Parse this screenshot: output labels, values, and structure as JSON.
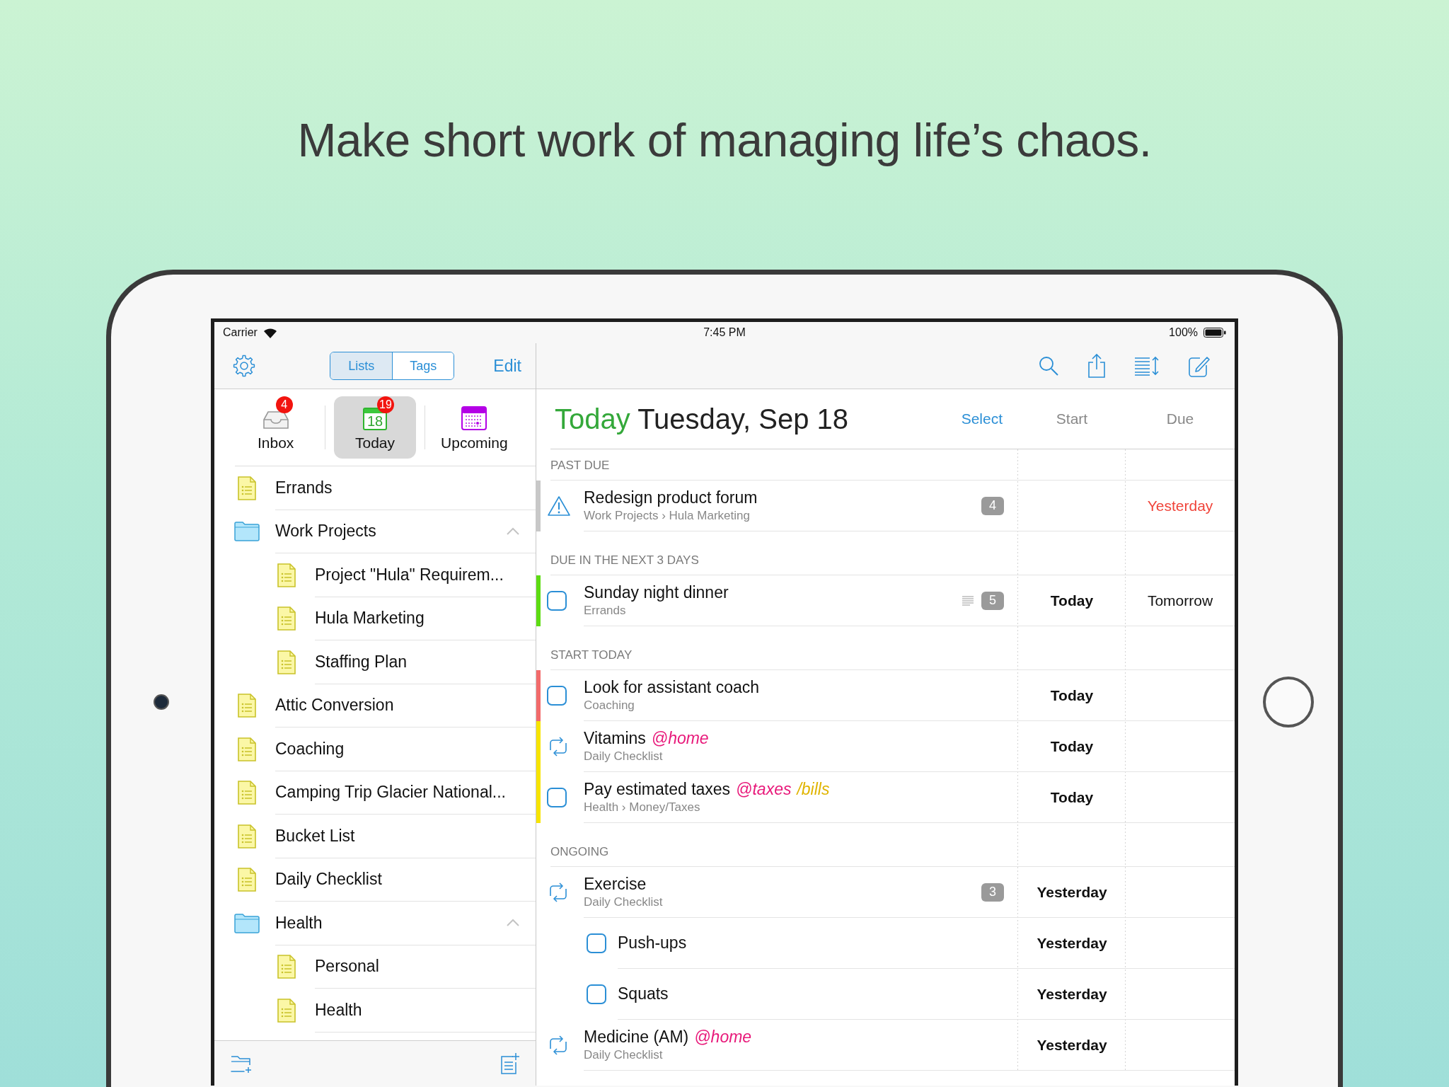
{
  "headline": "Make short work of managing life’s chaos.",
  "status_bar": {
    "carrier": "Carrier",
    "time": "7:45 PM",
    "battery": "100%"
  },
  "sidebar": {
    "tabs": [
      {
        "label": "Lists",
        "selected": true
      },
      {
        "label": "Tags",
        "selected": false
      }
    ],
    "edit": "Edit",
    "smart_lists": [
      {
        "kind": "inbox",
        "label": "Inbox",
        "badge": "4",
        "selected": false
      },
      {
        "kind": "today",
        "label": "Today",
        "badge": "19",
        "icon_text": "18",
        "selected": true
      },
      {
        "kind": "upcoming",
        "label": "Upcoming",
        "selected": false
      }
    ],
    "lists": [
      {
        "kind": "list",
        "name": "Errands"
      },
      {
        "kind": "folder",
        "name": "Work Projects",
        "expanded": true,
        "children": [
          {
            "kind": "list",
            "name": "Project \"Hula\" Requirem..."
          },
          {
            "kind": "list",
            "name": "Hula Marketing"
          },
          {
            "kind": "list",
            "name": "Staffing Plan"
          }
        ]
      },
      {
        "kind": "list",
        "name": "Attic Conversion"
      },
      {
        "kind": "list",
        "name": "Coaching"
      },
      {
        "kind": "list",
        "name": "Camping Trip Glacier National..."
      },
      {
        "kind": "list",
        "name": "Bucket List"
      },
      {
        "kind": "list",
        "name": "Daily Checklist"
      },
      {
        "kind": "folder",
        "name": "Health",
        "expanded": true,
        "children": [
          {
            "kind": "list",
            "name": "Personal"
          },
          {
            "kind": "list",
            "name": "Health"
          }
        ]
      }
    ]
  },
  "main": {
    "title": "Today",
    "date": "Tuesday, Sep 18",
    "select": "Select",
    "columns": [
      "Start",
      "Due"
    ],
    "sections": [
      {
        "title": "PAST DUE",
        "tasks": [
          {
            "kind": "overdue",
            "title": "Redesign product forum",
            "path": "Work Projects › Hula Marketing",
            "count": "4",
            "color": "#c8c8c8",
            "due": "Yesterday",
            "due_late": true
          }
        ]
      },
      {
        "title": "DUE IN THE NEXT 3 DAYS",
        "tasks": [
          {
            "kind": "checkbox",
            "checked": false,
            "title": "Sunday night dinner",
            "path": "Errands",
            "note": true,
            "count": "5",
            "color": "#5ddc12",
            "start": "Today",
            "due": "Tomorrow",
            "due_late": false
          }
        ]
      },
      {
        "title": "START TODAY",
        "tasks": [
          {
            "kind": "checkbox",
            "checked": false,
            "title": "Look for assistant coach",
            "path": "Coaching",
            "color": "#f26b6b",
            "start": "Today"
          },
          {
            "kind": "repeat",
            "title": "Vitamins",
            "tags": [
              {
                "kind": "context",
                "text": "@home"
              }
            ],
            "path": "Daily Checklist",
            "color": "#f7e400",
            "start": "Today"
          },
          {
            "kind": "checkbox",
            "checked": false,
            "title": "Pay estimated taxes",
            "tags": [
              {
                "kind": "context",
                "text": "@taxes"
              },
              {
                "kind": "folder",
                "text": "/bills"
              }
            ],
            "path": "Health › Money/Taxes",
            "color": "#f7e400",
            "start": "Today"
          }
        ]
      },
      {
        "title": "ONGOING",
        "tasks": [
          {
            "kind": "repeat",
            "title": "Exercise",
            "path": "Daily Checklist",
            "count": "3",
            "start": "Yesterday",
            "children": [
              {
                "kind": "checkbox",
                "checked": false,
                "title": "Push-ups",
                "start": "Yesterday"
              },
              {
                "kind": "checkbox",
                "checked": false,
                "title": "Squats",
                "start": "Yesterday"
              }
            ]
          },
          {
            "kind": "repeat",
            "title": "Medicine (AM)",
            "tags": [
              {
                "kind": "context",
                "text": "@home"
              }
            ],
            "path": "Daily Checklist",
            "start": "Yesterday"
          }
        ]
      }
    ]
  }
}
